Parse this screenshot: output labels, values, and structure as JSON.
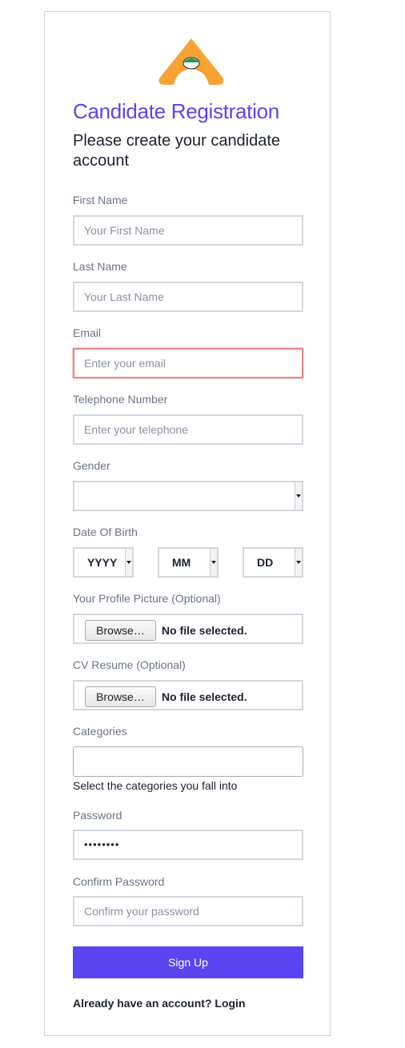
{
  "header": {
    "title": "Candidate Registration",
    "subtitle": "Please create your candidate account"
  },
  "brand": {
    "logo_icon": "arch-logo-icon",
    "primary_color": "#5b45f0",
    "logo_color": "#f7a334",
    "logo_accent": "#1e9b4a"
  },
  "form": {
    "first_name": {
      "label": "First Name",
      "placeholder": "Your First Name"
    },
    "last_name": {
      "label": "Last Name",
      "placeholder": "Your Last Name"
    },
    "email": {
      "label": "Email",
      "placeholder": "Enter your email"
    },
    "telephone": {
      "label": "Telephone Number",
      "placeholder": "Enter your telephone"
    },
    "gender": {
      "label": "Gender",
      "value": ""
    },
    "dob": {
      "label": "Date Of Birth",
      "year": "YYYY",
      "month": "MM",
      "day": "DD"
    },
    "profile_picture": {
      "label": "Your Profile Picture (Optional)",
      "browse_label": "Browse…",
      "status": "No file selected."
    },
    "cv": {
      "label": "CV Resume (Optional)",
      "browse_label": "Browse…",
      "status": "No file selected."
    },
    "categories": {
      "label": "Categories",
      "hint": "Select the categories you fall into"
    },
    "password": {
      "label": "Password",
      "value": "••••••••"
    },
    "confirm_password": {
      "label": "Confirm Password",
      "placeholder": "Confirm your password"
    },
    "submit_label": "Sign Up",
    "login_text": "Already have an account? Login"
  }
}
